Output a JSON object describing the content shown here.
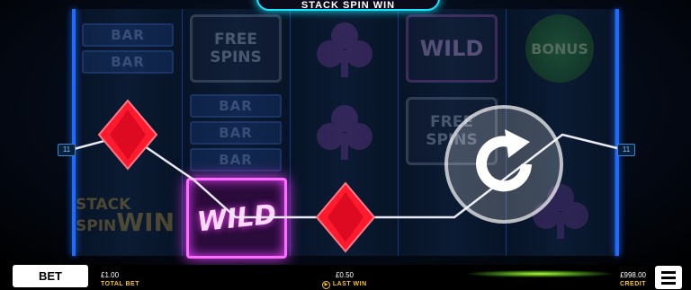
{
  "game": {
    "logo_text": "STACK SPIN WIN"
  },
  "reels": {
    "reel1": {
      "top": [
        "BAR",
        "BAR"
      ],
      "bottom_line1": "STACK",
      "bottom_line2": "SPIN",
      "bottom_win": "WIN"
    },
    "reel2": {
      "top_line1": "FREE",
      "top_line2": "SPINS",
      "middle": [
        "BAR",
        "BAR",
        "BAR"
      ],
      "wild": "WILD"
    },
    "reel4": {
      "top": "WILD",
      "middle_line1": "FREE",
      "middle_line2": "SPINS"
    },
    "reel5": {
      "top": "BONUS"
    }
  },
  "paylines": {
    "left_label": "11",
    "right_label": "11",
    "color": "#e9e9f3"
  },
  "colors": {
    "diamond": "#ff1a2e",
    "wild_glow": "#e040fb",
    "reel_divider": "#1f6bff",
    "accent": "#f5c518"
  },
  "bottom_bar": {
    "bet_label": "BET",
    "total_bet_value": "£1.00",
    "total_bet_label": "TOTAL BET",
    "last_win_value": "£0.50",
    "last_win_label": "LAST WIN",
    "credit_value": "£998.00",
    "credit_label": "CREDIT",
    "menu_icon": "hamburger-menu-icon",
    "last_win_icon": "play-circle-icon"
  },
  "spin_button": {
    "icon": "refresh-arrow-icon"
  }
}
